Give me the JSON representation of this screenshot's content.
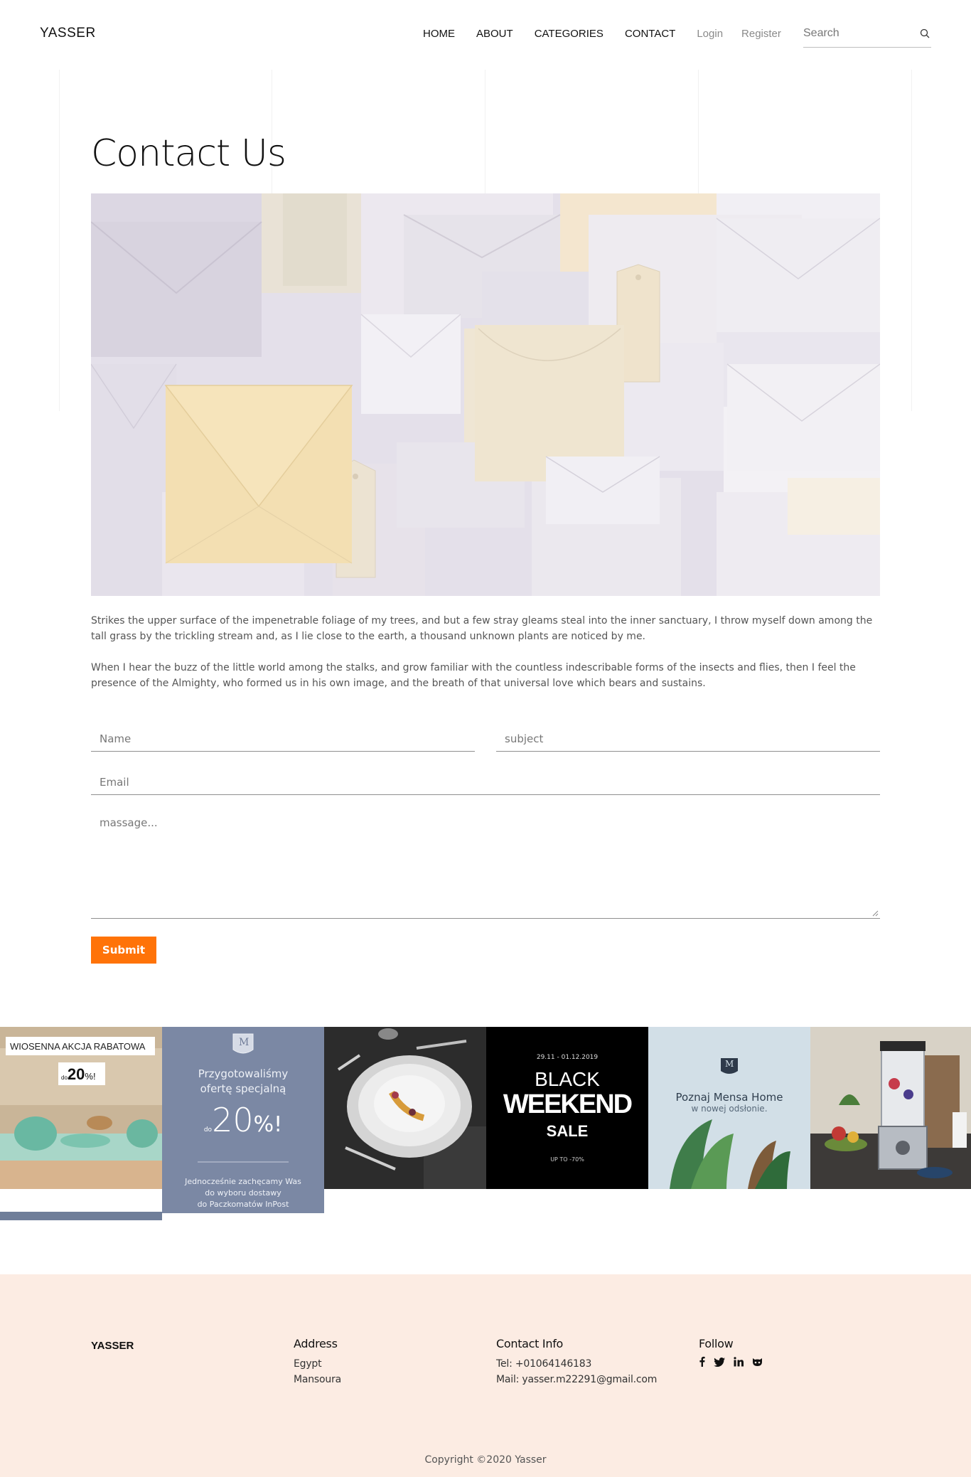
{
  "header": {
    "brand": "YASSER",
    "nav": {
      "home": "HOME",
      "about": "ABOUT",
      "categories": "CATEGORIES",
      "contact": "CONTACT",
      "login": "Login",
      "register": "Register"
    },
    "search_placeholder": "Search"
  },
  "page": {
    "title": "Contact Us",
    "paragraph1": "Strikes the upper surface of the impenetrable foliage of my trees, and but a few stray gleams steal into the inner sanctuary, I throw myself down among the tall grass by the trickling stream and, as I lie close to the earth, a thousand unknown plants are noticed by me.",
    "paragraph2": "When I hear the buzz of the little world among the stalks, and grow familiar with the countless indescribable forms of the insects and flies, then I feel the presence of the Almighty, who formed us in his own image, and the breath of that universal love which bears and sustains."
  },
  "form": {
    "name_placeholder": "Name",
    "subject_placeholder": "subject",
    "email_placeholder": "Email",
    "message_placeholder": "massage...",
    "submit_label": "Submit"
  },
  "promos": {
    "tile1": {
      "text": "WIOSENNA AKCJA RABATOWA",
      "badge_prefix": "do",
      "badge_value": "20",
      "badge_suffix": "%!"
    },
    "tile2": {
      "logo": "M",
      "line1": "Przygotowaliśmy",
      "line2": "ofertę specjalną",
      "prefix": "do",
      "value": "20",
      "suffix": "%!",
      "small1": "Jednocześnie zachęcamy Was",
      "small2": "do wyboru dostawy",
      "small3": "do Paczkomatów InPost"
    },
    "tile4": {
      "dates": "29.11 - 01.12.2019",
      "black": "BLACK",
      "weekend": "WEEKEND",
      "sale": "SALE",
      "upto": "UP TO -70%"
    },
    "tile5": {
      "logo": "M",
      "line1": "Poznaj Mensa Home",
      "line2": "w nowej odsłonie."
    }
  },
  "footer": {
    "brand": "YASSER",
    "address_heading": "Address",
    "address_line1": "Egypt",
    "address_line2": "Mansoura",
    "contact_heading": "Contact Info",
    "contact_tel": "Tel: +01064146183",
    "contact_mail": "Mail: yasser.m22291@gmail.com",
    "follow_heading": "Follow",
    "copyright": "Copyright ©2020 Yasser"
  },
  "colors": {
    "accent": "#ff7308",
    "footer_bg": "#fcece3"
  },
  "icons": {
    "search": "search-icon",
    "social": [
      "facebook-icon",
      "twitter-icon",
      "linkedin-icon",
      "github-icon"
    ]
  }
}
